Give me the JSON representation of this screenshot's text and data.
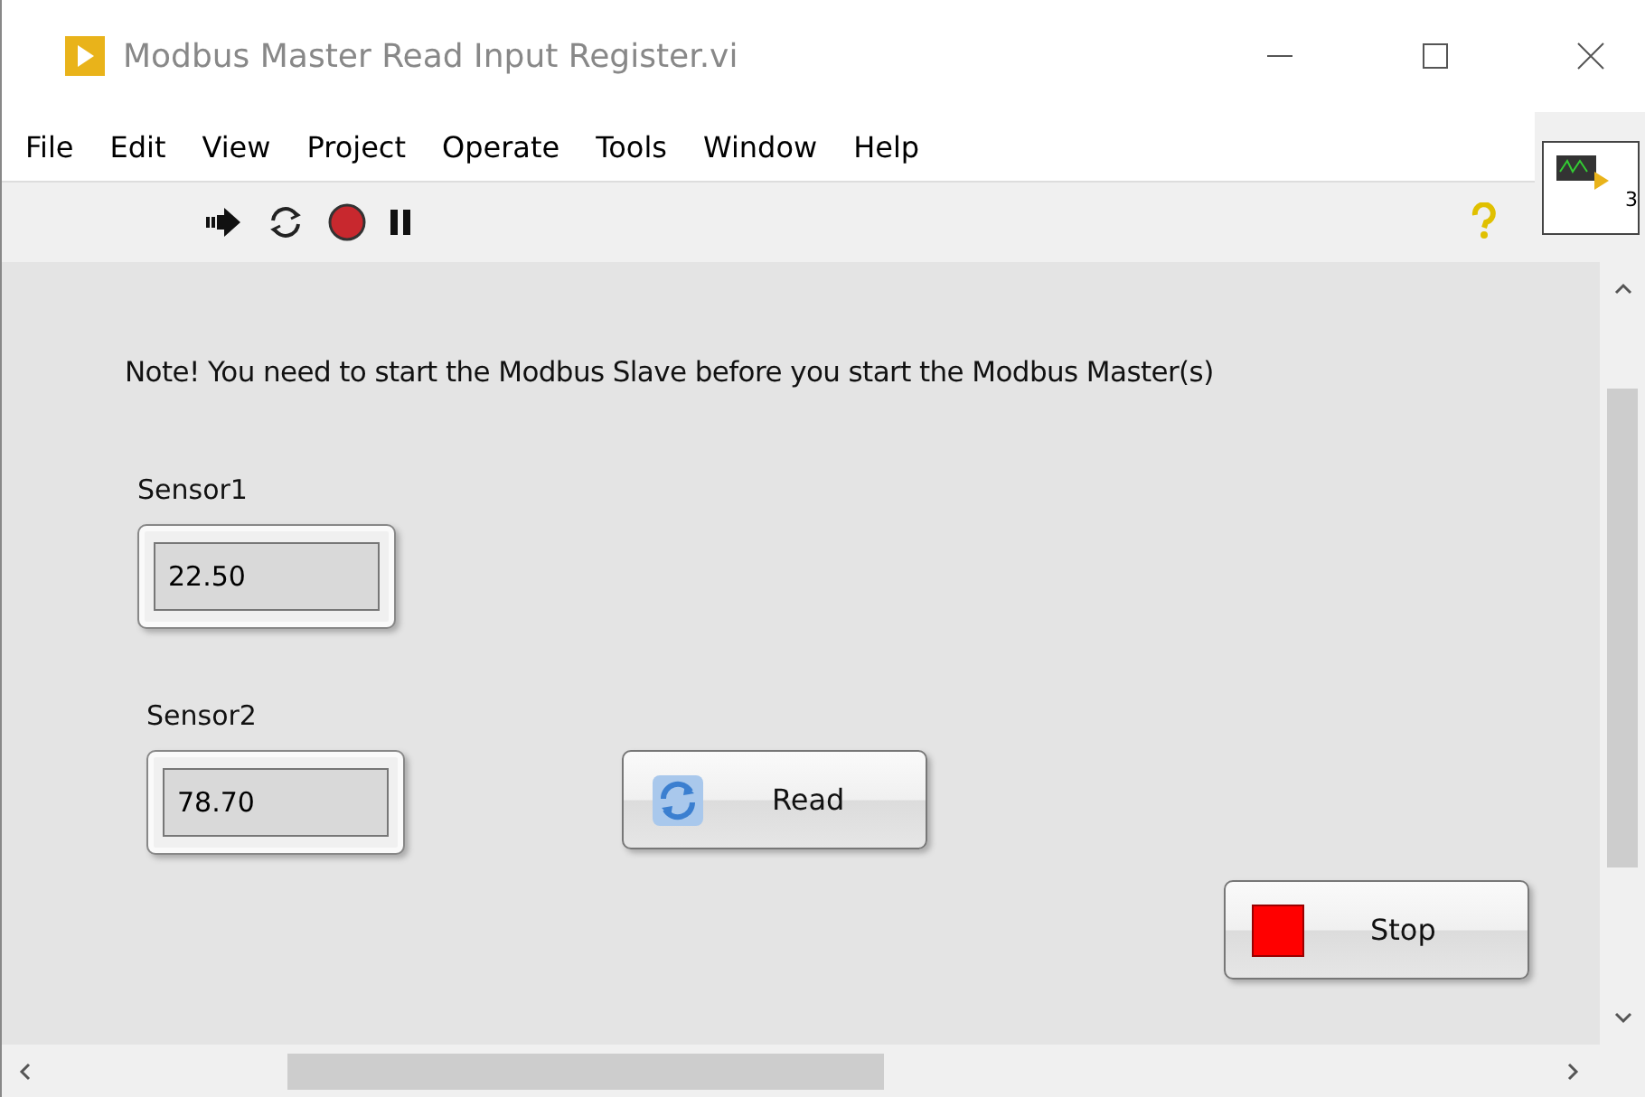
{
  "window": {
    "title": "Modbus Master Read Input Register.vi"
  },
  "menu": [
    "File",
    "Edit",
    "View",
    "Project",
    "Operate",
    "Tools",
    "Window",
    "Help"
  ],
  "vi_icon": {
    "label": "3"
  },
  "panel": {
    "note": "Note! You need to start the Modbus Slave before you start the Modbus Master(s)",
    "indicators": [
      {
        "label": "Sensor1",
        "value": "22.50"
      },
      {
        "label": "Sensor2",
        "value": "78.70"
      }
    ],
    "buttons": [
      {
        "kind": "read",
        "label": "Read"
      },
      {
        "kind": "stop",
        "label": "Stop"
      }
    ]
  }
}
